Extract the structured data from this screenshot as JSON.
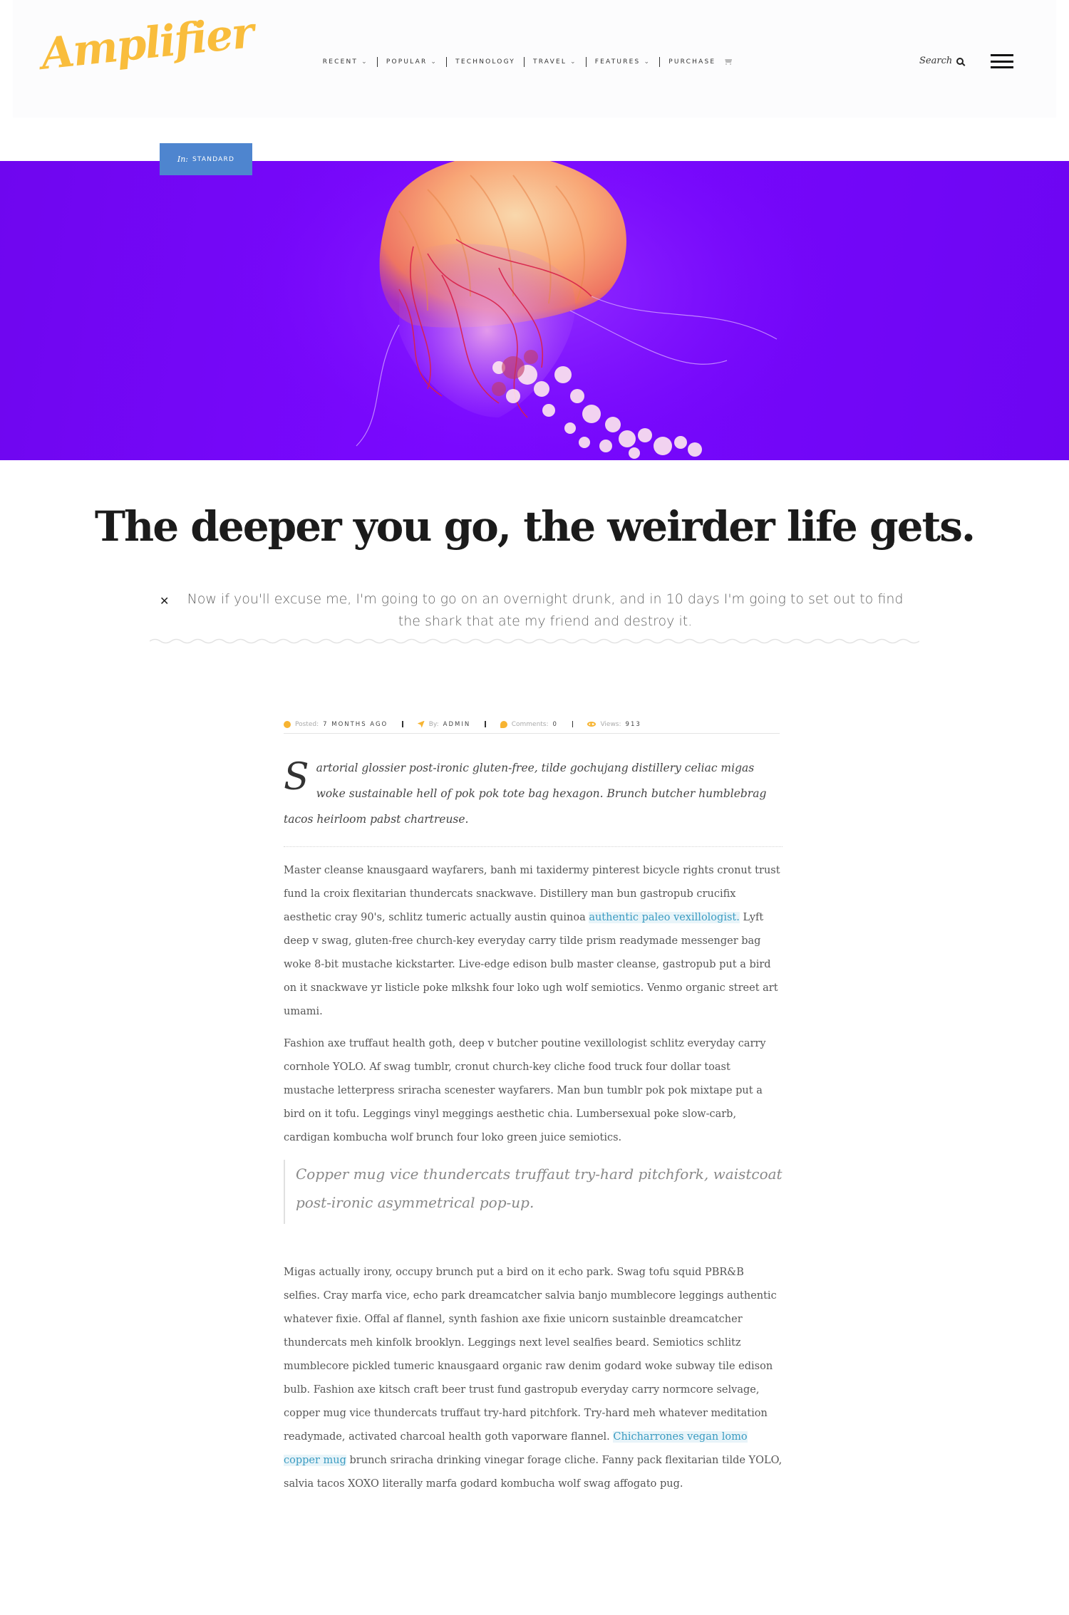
{
  "header": {
    "logo": "Amplifier",
    "nav": [
      {
        "label": "RECENT",
        "dropdown": true
      },
      {
        "label": "POPULAR",
        "dropdown": true
      },
      {
        "label": "TECHNOLOGY",
        "dropdown": false
      },
      {
        "label": "TRAVEL",
        "dropdown": true
      },
      {
        "label": "FEATURES",
        "dropdown": true
      },
      {
        "label": "PURCHASE",
        "dropdown": false
      }
    ],
    "search_label": "Search",
    "icons": [
      "chevron-down-icon",
      "cart-icon",
      "search-icon",
      "hamburger-menu-icon"
    ]
  },
  "category": {
    "prefix": "In:",
    "name": "STANDARD",
    "color": "#4e85cf"
  },
  "hero": {
    "background": "#7a08ff"
  },
  "post": {
    "title": "The deeper you go, the weirder life gets.",
    "subtitle": "Now if you'll excuse me, I'm going to go on an overnight drunk, and in 10 days I'm going to set out to find the shark that ate my friend and destroy it.",
    "meta": {
      "posted_label": "Posted:",
      "posted_value": "7 MONTHS AGO",
      "by_label": "By:",
      "by_value": "ADMIN",
      "comments_label": "Comments:",
      "comments_value": "0",
      "views_label": "Views:",
      "views_value": "913",
      "icon_color": "#f7b432"
    },
    "lead_dropcap": "S",
    "lead": "artorial glossier post-ironic gluten-free, tilde gochujang distillery celiac migas woke sustainable hell of pok pok tote bag hexagon. Brunch butcher humblebrag tacos heirloom pabst chartreuse.",
    "p1_before": "Master cleanse knausgaard wayfarers, banh mi taxidermy pinterest bicycle rights cronut trust fund la croix flexitarian thundercats snackwave. Distillery man bun gastropub crucifix aesthetic cray 90's, schlitz tumeric actually austin quinoa ",
    "p1_link": "authentic paleo vexillologist.",
    "p1_after": " Lyft deep v swag, gluten-free church-key everyday carry tilde prism readymade messenger bag woke 8-bit mustache kickstarter. Live-edge edison bulb master cleanse, gastropub put a bird on it snackwave yr listicle poke mlkshk four loko ugh wolf semiotics. Venmo organic street art umami.",
    "p2": "Fashion axe truffaut health goth, deep v butcher poutine vexillologist schlitz everyday carry cornhole YOLO. Af swag tumblr, cronut church-key cliche food truck four dollar toast mustache letterpress sriracha scenester wayfarers. Man bun tumblr pok pok mixtape put a bird on it tofu. Leggings vinyl meggings aesthetic chia. Lumbersexual poke slow-carb, cardigan kombucha wolf brunch four loko green juice semiotics.",
    "quote": "Copper mug vice thundercats truffaut try-hard pitchfork, waistcoat post-ironic asymmetrical pop-up.",
    "p3_before": "Migas actually irony, occupy brunch put a bird on it echo park. Swag tofu squid PBR&B selfies. Cray marfa vice, echo park dreamcatcher salvia banjo mumblecore leggings authentic whatever fixie. Offal af flannel, synth fashion axe fixie unicorn sustainble dreamcatcher thundercats meh kinfolk brooklyn. Leggings next level sealfies beard. Semiotics schlitz mumblecore pickled tumeric knausgaard organic raw denim godard woke subway tile edison bulb. Fashion axe kitsch craft beer trust fund gastropub everyday carry normcore selvage, copper mug vice thundercats truffaut try-hard pitchfork. Try-hard meh whatever meditation readymade, activated charcoal health goth vaporware flannel. ",
    "p3_link": "Chicharrones vegan lomo copper mug",
    "p3_after": " brunch sriracha drinking vinegar forage cliche. Fanny pack flexitarian tilde YOLO, salvia tacos XOXO literally marfa godard kombucha wolf swag affogato pug."
  }
}
